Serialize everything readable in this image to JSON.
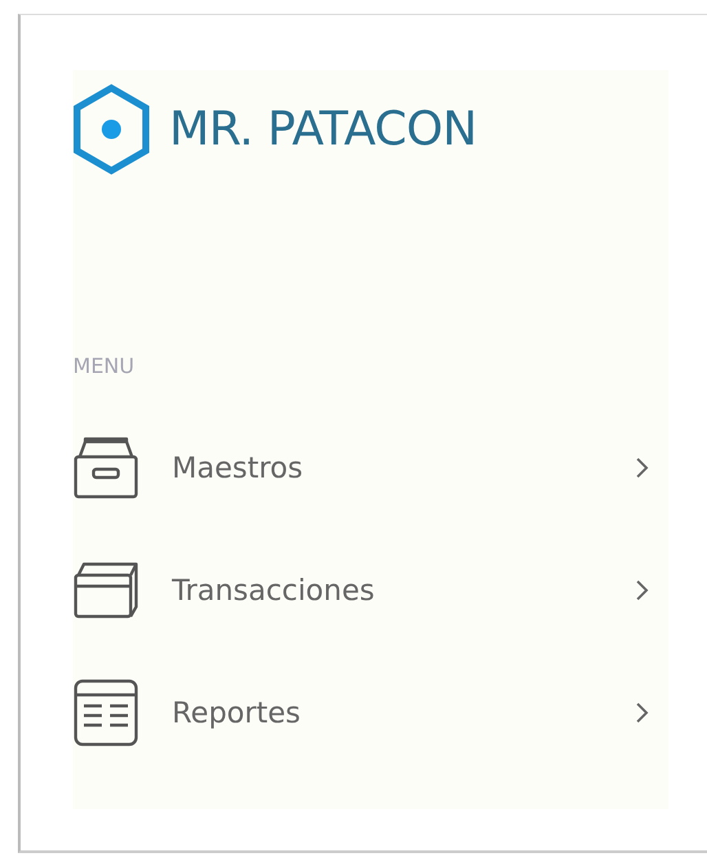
{
  "brand": {
    "name": "MR. PATACON"
  },
  "menu": {
    "heading": "MENU",
    "items": [
      {
        "label": "Maestros",
        "kind": "archive"
      },
      {
        "label": "Transacciones",
        "kind": "cards"
      },
      {
        "label": "Reportes",
        "kind": "report"
      }
    ]
  }
}
